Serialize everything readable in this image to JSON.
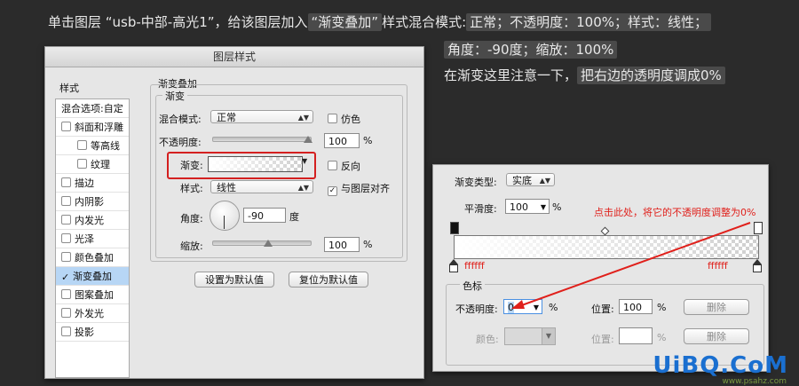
{
  "instructions": {
    "line1_prefix": "单击图层 “usb-中部-高光1”，给该图层加入",
    "line1_quote": "“渐变叠加”",
    "line1_mid": "样式混合模式:",
    "line1_settings": "正常；不透明度：100%；样式：线性；",
    "line2": "角度：-90度；缩放：100%",
    "line3_prefix": "在渐变这里注意一下，",
    "line3_highlight": "把右边的透明度调成0%"
  },
  "dialog": {
    "title": "图层样式",
    "left_header": "样式",
    "left_items": [
      {
        "label": "混合选项:自定",
        "check": false,
        "indent": false,
        "plain": true
      },
      {
        "label": "斜面和浮雕",
        "check": false,
        "indent": false
      },
      {
        "label": "等高线",
        "check": false,
        "indent": true
      },
      {
        "label": "纹理",
        "check": false,
        "indent": true
      },
      {
        "label": "描边",
        "check": false,
        "indent": false
      },
      {
        "label": "内阴影",
        "check": false,
        "indent": false
      },
      {
        "label": "内发光",
        "check": false,
        "indent": false
      },
      {
        "label": "光泽",
        "check": false,
        "indent": false
      },
      {
        "label": "颜色叠加",
        "check": false,
        "indent": false
      },
      {
        "label": "渐变叠加",
        "check": true,
        "indent": false,
        "selected": true
      },
      {
        "label": "图案叠加",
        "check": false,
        "indent": false
      },
      {
        "label": "外发光",
        "check": false,
        "indent": false
      },
      {
        "label": "投影",
        "check": false,
        "indent": false
      }
    ],
    "section_title": "渐变叠加",
    "group_title": "渐变",
    "blend_mode_label": "混合模式:",
    "blend_mode_value": "正常",
    "dither_label": "仿色",
    "opacity_label": "不透明度:",
    "opacity_value": "100",
    "opacity_unit": "%",
    "gradient_label": "渐变:",
    "reverse_label": "反向",
    "style_label": "样式:",
    "style_value": "线性",
    "align_label": "与图层对齐",
    "angle_label": "角度:",
    "angle_value": "-90",
    "angle_unit": "度",
    "scale_label": "缩放:",
    "scale_value": "100",
    "scale_unit": "%",
    "set_default_label": "设置为默认值",
    "reset_default_label": "复位为默认值"
  },
  "editor": {
    "type_label": "渐变类型:",
    "type_value": "实底",
    "smooth_label": "平滑度:",
    "smooth_value": "100",
    "smooth_unit": "%",
    "annotation": "点击此处，将它的不透明度调整为0%",
    "left_color": "ffffff",
    "right_color": "ffffff",
    "stops_group": "色标",
    "opacity_label": "不透明度:",
    "opacity_value": "0",
    "opacity_unit": "%",
    "position_label": "位置:",
    "position_value": "100",
    "position_unit": "%",
    "delete_label": "删除",
    "color_label": "颜色:",
    "position2_label": "位置:",
    "position2_unit": "%",
    "delete2_label": "删除"
  },
  "watermark": {
    "main": "UiBQ.CoM",
    "sub": "www.psahz.com"
  },
  "colors": {
    "annotation_red": "#e0201b",
    "selected_item": "#b7d6f5",
    "background": "#2b2b2b"
  }
}
